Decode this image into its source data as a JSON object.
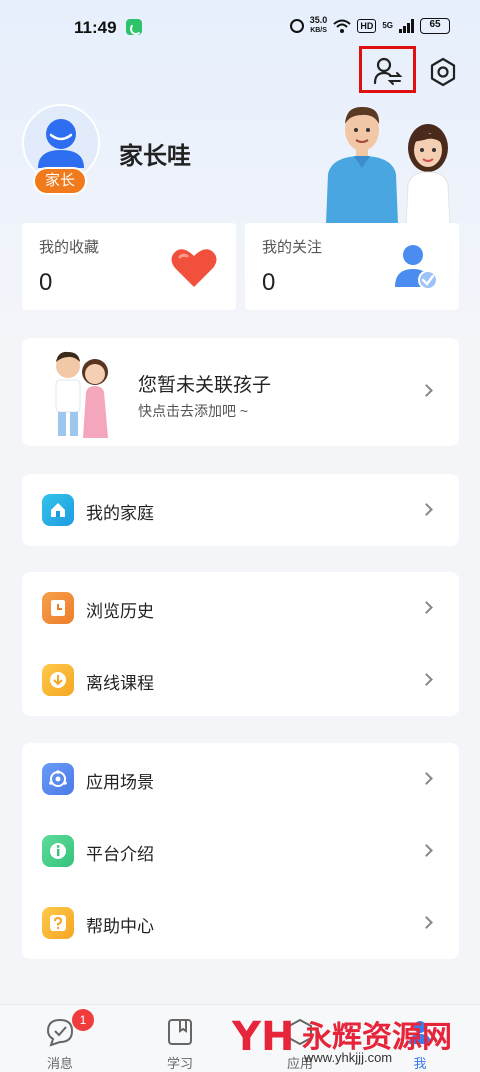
{
  "status_bar": {
    "time": "11:49",
    "net_speed_value": "35.0",
    "net_speed_unit": "KB/S",
    "hd_label": "HD",
    "signal_label": "5G",
    "battery": "65"
  },
  "profile": {
    "name": "家长哇",
    "role_badge": "家长"
  },
  "stats": {
    "favorites_label": "我的收藏",
    "favorites_value": "0",
    "following_label": "我的关注",
    "following_value": "0"
  },
  "child_link": {
    "title": "您暂未关联孩子",
    "subtitle": "快点击去添加吧 ~"
  },
  "menu": {
    "family": "我的家庭",
    "history": "浏览历史",
    "offline": "离线课程",
    "scenarios": "应用场景",
    "platform": "平台介绍",
    "help": "帮助中心"
  },
  "bottom_nav": {
    "messages": "消息",
    "messages_badge": "1",
    "study": "学习",
    "apps": "应用",
    "mine": "我"
  },
  "watermark": {
    "logo": "YH",
    "text": "永辉资源网",
    "url": "www.yhkjjj.com"
  },
  "colors": {
    "accent_blue": "#3a7bf0",
    "badge_orange": "#f07a1c",
    "heart_red": "#f0503c",
    "highlight_red": "#e01010"
  },
  "icons": {
    "switch_account": "person-switch-icon",
    "settings": "hexagon-gear-icon",
    "favorites": "heart-icon",
    "following": "person-check-icon"
  }
}
